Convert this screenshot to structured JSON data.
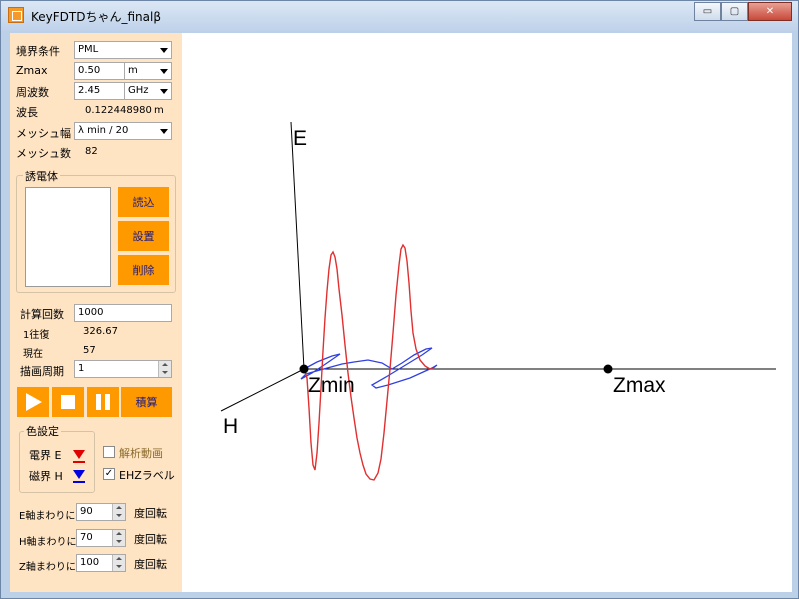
{
  "window": {
    "title": "KeyFDTDちゃん_finalβ",
    "buttons": {
      "minimize": "▭",
      "maximize": "▢",
      "close": "✕"
    }
  },
  "settings": {
    "boundary": {
      "label": "境界条件",
      "value": "PML"
    },
    "zmax": {
      "label": "Zmax",
      "value": "0.50",
      "unit": "m"
    },
    "frequency": {
      "label": "周波数",
      "value": "2.45",
      "unit": "GHz"
    },
    "wavelength": {
      "label": "波長",
      "value": "0.122448980",
      "unit": "m"
    },
    "mesh_width": {
      "label": "メッシュ幅",
      "value": "λ min / 20"
    },
    "mesh_count": {
      "label": "メッシュ数",
      "value": "82"
    }
  },
  "dielectric": {
    "title": "誘電体",
    "load_label": "読込",
    "place_label": "設置",
    "delete_label": "削除"
  },
  "compute": {
    "iterations": {
      "label": "計算回数",
      "value": "1000"
    },
    "round_trip": {
      "label": "1往復",
      "value": "326.67"
    },
    "current": {
      "label": "現在",
      "value": "57"
    },
    "draw_period": {
      "label": "描画周期",
      "value": "1"
    }
  },
  "controls": {
    "play_icon": "play-icon",
    "stop_icon": "stop-icon",
    "pause_icon": "pause-icon",
    "accumulate_label": "積算"
  },
  "colors": {
    "title": "色設定",
    "e_label": "電界 E",
    "h_label": "磁界 H",
    "e_color": "#e00000",
    "h_color": "#0000e0"
  },
  "options": {
    "analytic": {
      "label": "解析動画",
      "checked": false
    },
    "ehz_label": {
      "label": "EHZラベル",
      "checked": true
    }
  },
  "rotation": {
    "e_axis": {
      "label": "E軸まわりに",
      "value": "90",
      "suffix": "度回転"
    },
    "h_axis": {
      "label": "H軸まわりに",
      "value": "70",
      "suffix": "度回転"
    },
    "z_axis": {
      "label": "Z軸まわりに",
      "value": "100",
      "suffix": "度回転"
    }
  },
  "plot": {
    "labels": {
      "e": "E",
      "h": "H",
      "zmin": "Zmin",
      "zmax": "Zmax"
    },
    "e_wave_color": "#e03030",
    "h_wave_color": "#3040e0"
  }
}
